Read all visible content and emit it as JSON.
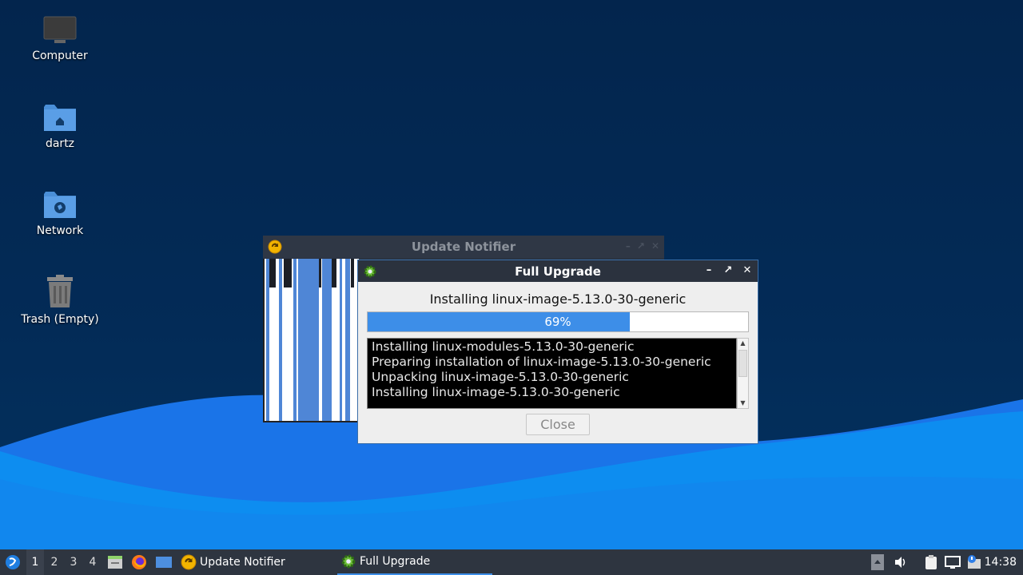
{
  "desktop": {
    "icons": [
      {
        "label": "Computer",
        "icon": "computer-icon"
      },
      {
        "label": "dartz",
        "icon": "home-folder-icon"
      },
      {
        "label": "Network",
        "icon": "network-folder-icon"
      },
      {
        "label": "Trash (Empty)",
        "icon": "trash-icon"
      }
    ]
  },
  "update_notifier": {
    "title": "Update Notifier"
  },
  "full_upgrade": {
    "title": "Full Upgrade",
    "status": "Installing linux-image-5.13.0-30-generic",
    "progress_percent": 69,
    "progress_label": "69%",
    "log": [
      "Installing linux-modules-5.13.0-30-generic",
      "Preparing installation of linux-image-5.13.0-30-generic",
      "Unpacking linux-image-5.13.0-30-generic",
      "Installing linux-image-5.13.0-30-generic"
    ],
    "close_label": "Close"
  },
  "taskbar": {
    "workspaces": [
      "1",
      "2",
      "3",
      "4"
    ],
    "active_workspace": "1",
    "tasks": [
      {
        "label": "Update Notifier",
        "icon": "update-notifier-icon"
      },
      {
        "label": "Full Upgrade",
        "icon": "gear-icon"
      }
    ],
    "clock": "14:38"
  },
  "colors": {
    "accent": "#3d8ee8",
    "desktop_bg": "#03254d",
    "titlebar": "#2b323e",
    "taskbar": "#2e3540"
  }
}
